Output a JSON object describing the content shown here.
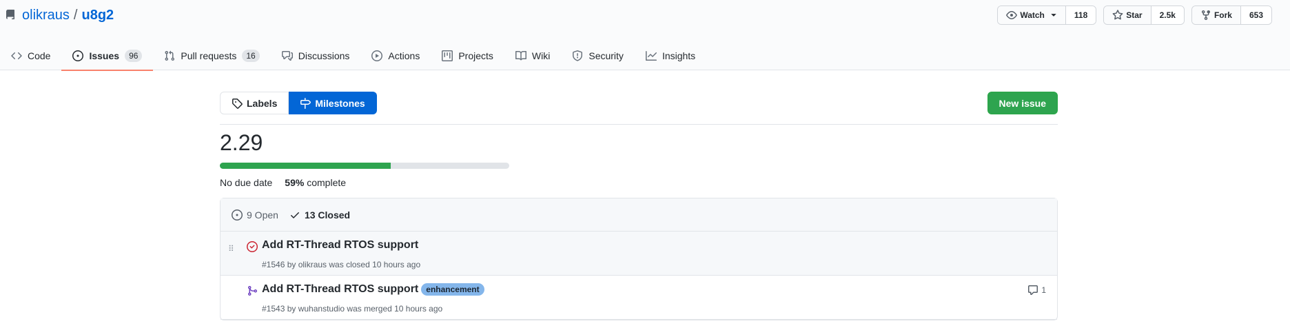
{
  "repo": {
    "owner": "olikraus",
    "separator": "/",
    "name": "u8g2"
  },
  "header_actions": [
    {
      "label": "Watch",
      "count": "118",
      "icon": "eye-icon"
    },
    {
      "label": "Star",
      "count": "2.5k",
      "icon": "star-icon"
    },
    {
      "label": "Fork",
      "count": "653",
      "icon": "fork-icon"
    }
  ],
  "tabs": [
    {
      "label": "Code",
      "icon": "code-icon"
    },
    {
      "label": "Issues",
      "count": "96",
      "icon": "issue-icon",
      "selected": true
    },
    {
      "label": "Pull requests",
      "count": "16",
      "icon": "pull-request-icon"
    },
    {
      "label": "Discussions",
      "icon": "discussions-icon"
    },
    {
      "label": "Actions",
      "icon": "play-icon"
    },
    {
      "label": "Projects",
      "icon": "project-icon"
    },
    {
      "label": "Wiki",
      "icon": "book-icon"
    },
    {
      "label": "Security",
      "icon": "shield-icon"
    },
    {
      "label": "Insights",
      "icon": "graph-icon"
    }
  ],
  "toolbar": {
    "labels": "Labels",
    "milestones": "Milestones",
    "new_issue": "New issue"
  },
  "milestone": {
    "title": "2.29",
    "due": "No due date",
    "percent_value": "59%",
    "percent_suffix": " complete",
    "progress_fraction": 0.59
  },
  "list": {
    "open_label": "9 Open",
    "closed_label": "13 Closed",
    "items": [
      {
        "title": "Add RT-Thread RTOS support",
        "meta": "#1546 by olikraus was closed 10 hours ago",
        "state": "closed"
      },
      {
        "title": "Add RT-Thread RTOS support",
        "label": "enhancement",
        "meta": "#1543 by wuhanstudio was merged 10 hours ago",
        "comments": "1",
        "state": "merged"
      }
    ]
  },
  "colors": {
    "accent": "#0366d6",
    "success": "#2ea44f",
    "tab_underline": "#f9826c",
    "closed_red": "#cb2431",
    "merged_purple": "#6f42c1"
  }
}
